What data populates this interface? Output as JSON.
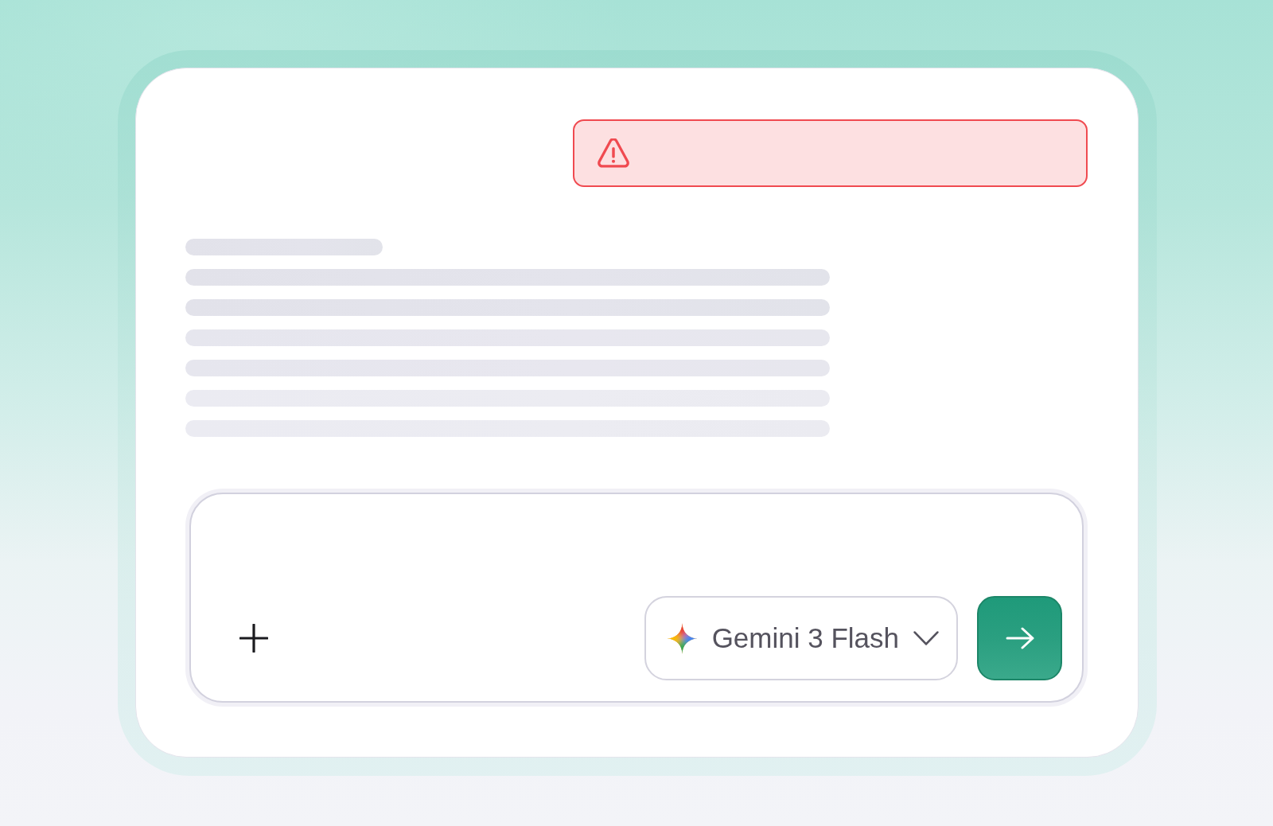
{
  "alert": {
    "kind": "error"
  },
  "response_skeleton": [
    {
      "kind": "short"
    },
    {
      "kind": "long"
    },
    {
      "kind": "long"
    },
    {
      "kind": "long"
    },
    {
      "kind": "long"
    },
    {
      "kind": "long"
    },
    {
      "kind": "long"
    }
  ],
  "composer": {
    "model_selector": {
      "label": "Gemini 3 Flash"
    }
  }
}
